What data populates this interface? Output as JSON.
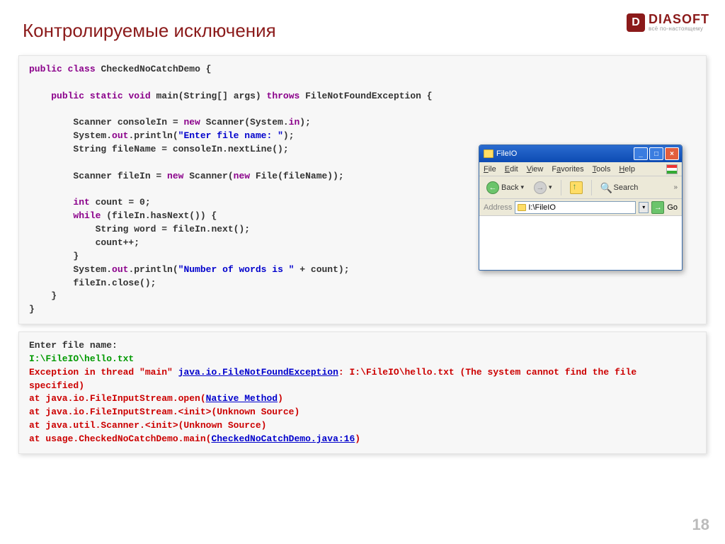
{
  "title": "Контролируемые исключения",
  "logo": {
    "brand": "DIASOFT",
    "tagline": "всё по-настоящему",
    "mark": "D"
  },
  "page_number": "18",
  "code": {
    "l1a": "public",
    "l1b": "class",
    "l1c": " CheckedNoCatchDemo {",
    "l2a": "public",
    "l2b": "static",
    "l2c": "void",
    "l2d": " main(String[] args) ",
    "l2e": "throws",
    "l2f": " FileNotFoundException {",
    "l3a": "        Scanner consoleIn = ",
    "l3b": "new",
    "l3c": " Scanner(System.",
    "l3d": "in",
    "l3e": ");",
    "l4a": "        System.",
    "l4b": "out",
    "l4c": ".println(",
    "l4d": "\"Enter file name: \"",
    "l4e": ");",
    "l5": "        String fileName = consoleIn.nextLine();",
    "l6a": "        Scanner fileIn = ",
    "l6b": "new",
    "l6c": " Scanner(",
    "l6d": "new",
    "l6e": " File(fileName));",
    "l7a": "int",
    "l7b": " count = 0;",
    "l8a": "while",
    "l8b": " (fileIn.hasNext()) {",
    "l9": "            String word = fileIn.next();",
    "l10": "            count++;",
    "l11": "        }",
    "l12a": "        System.",
    "l12b": "out",
    "l12c": ".println(",
    "l12d": "\"Number of words is \"",
    "l12e": " + count);",
    "l13": "        fileIn.close();",
    "l14": "    }",
    "l15": "}"
  },
  "console": {
    "c1": "Enter file name:",
    "c2": "I:\\FileIO\\hello.txt",
    "c3": "Exception in thread \"main\" ",
    "c3b": "java.io.FileNotFoundException",
    "c3c": ": I:\\FileIO\\hello.txt (The system cannot find the file specified)",
    "c4": "at java.io.FileInputStream.open(",
    "c4b": "Native Method",
    "c4c": ")",
    "c5": "at java.io.FileInputStream.<init>(Unknown Source)",
    "c6": "at java.util.Scanner.<init>(Unknown Source)",
    "c7": "at usage.CheckedNoCatchDemo.main(",
    "c7b": "CheckedNoCatchDemo.java:16",
    "c7c": ")"
  },
  "explorer": {
    "title": "FileIO",
    "menu": {
      "file": "File",
      "edit": "Edit",
      "view": "View",
      "favorites": "Favorites",
      "tools": "Tools",
      "help": "Help"
    },
    "back": "Back",
    "search": "Search",
    "address_label": "Address",
    "address_value": "I:\\FileIO",
    "go": "Go"
  }
}
